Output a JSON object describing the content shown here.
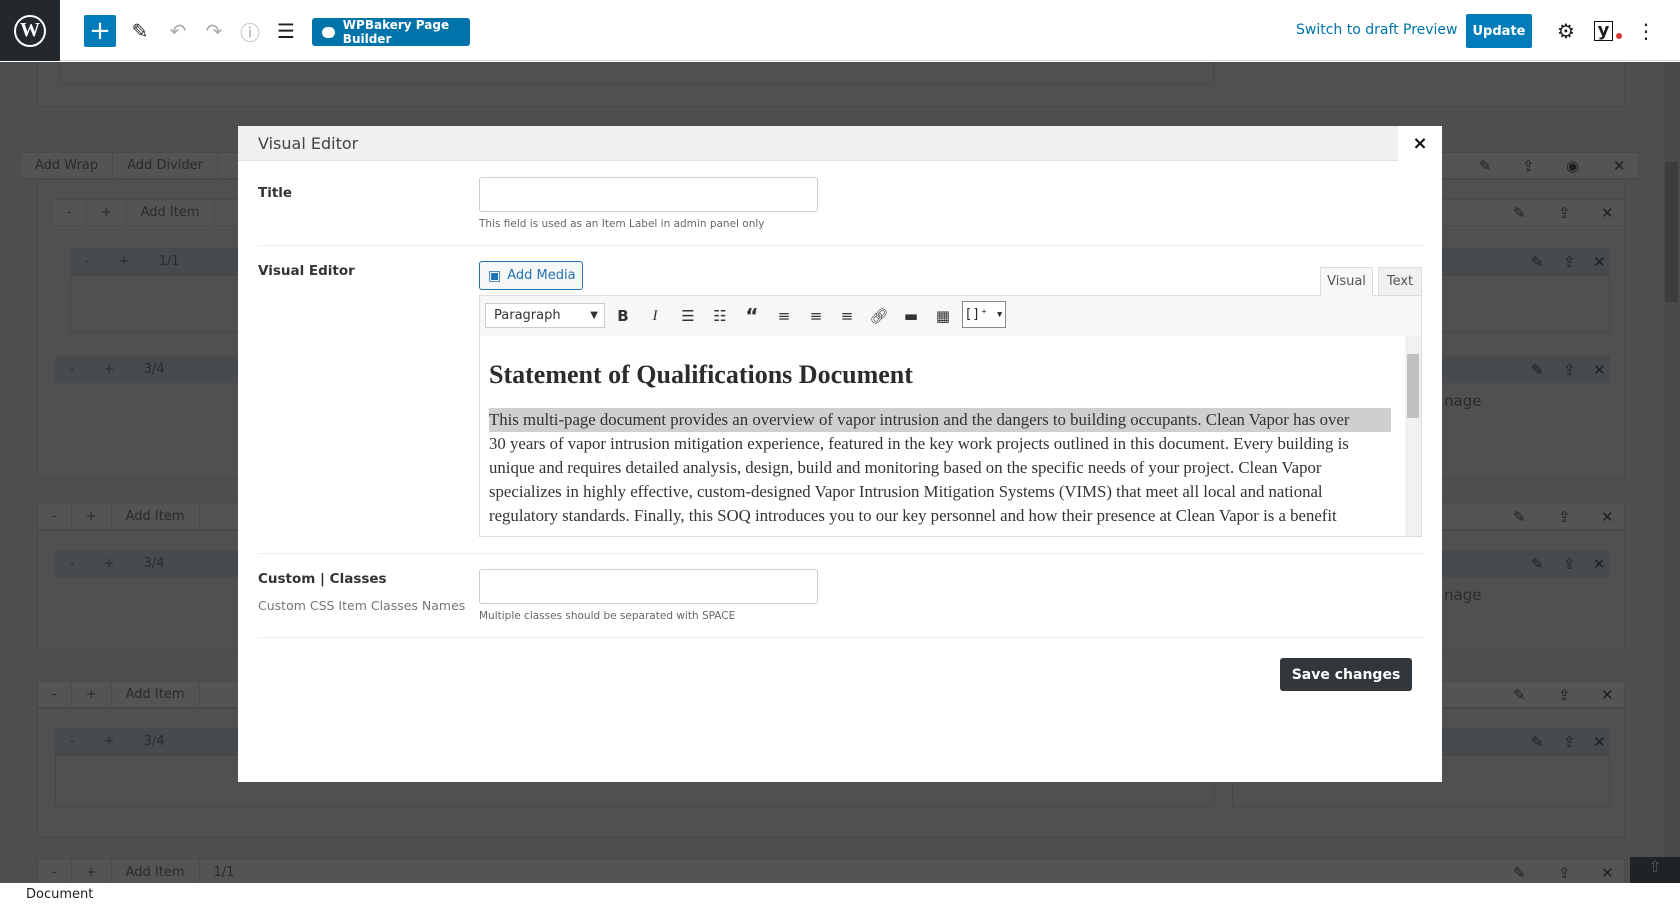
{
  "topbar": {
    "logo": "W",
    "add_block_icon": "plus-icon",
    "tools": [
      "pencil-icon",
      "undo-icon",
      "redo-icon",
      "info-icon",
      "list-view-icon"
    ],
    "wpbakery_label": "WPBakery Page Builder",
    "switch_draft": "Switch to draft",
    "preview": "Preview",
    "update": "Update",
    "yoast": "y",
    "accent": "#007cba"
  },
  "builder": {
    "add_wrap": "Add Wrap",
    "add_divider": "Add Divider",
    "minus": "-",
    "plus": "+",
    "add_item": "Add Item",
    "col_full": "1/1",
    "col_three_quarter": "3/4",
    "image_label": "nage"
  },
  "modal": {
    "title": "Visual Editor",
    "close": "×",
    "title_field": {
      "label": "Title",
      "value": "",
      "help": "This field is used as an Item Label in admin panel only"
    },
    "editor_field": {
      "label": "Visual Editor",
      "add_media": "Add Media",
      "tabs": [
        "Visual",
        "Text"
      ],
      "active_tab": "Visual",
      "format_select": "Paragraph",
      "heading": "Statement of Qualifications Document",
      "paragraph_lines": [
        "This multi-page document provides an overview of vapor intrusion and the dangers to building occupants. Clean Vapor has over",
        "30 years of vapor intrusion mitigation experience, featured in the key work projects outlined in this document. Every building is",
        "unique and requires detailed analysis, design, build and monitoring based on the specific needs of your project. Clean Vapor",
        "specializes in highly effective, custom-designed Vapor Intrusion Mitigation Systems (VIMS) that meet all local and national",
        "regulatory standards. Finally, this SOQ introduces you to our key personnel and how their presence at Clean Vapor is a benefit"
      ],
      "shortcode_button": "[]⁺ ▾"
    },
    "classes_field": {
      "label": "Custom | Classes",
      "sublabel": "Custom CSS Item Classes Names",
      "value": "",
      "help": "Multiple classes should be separated with SPACE"
    },
    "save": "Save changes"
  },
  "status": {
    "breadcrumb": "Document"
  }
}
